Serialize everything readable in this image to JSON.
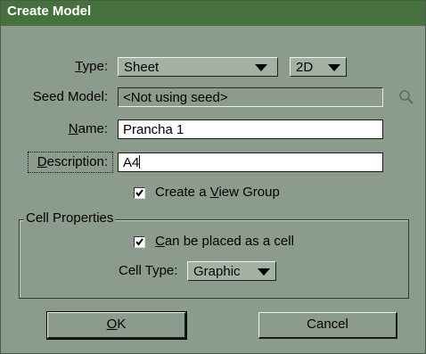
{
  "dialog": {
    "title": "Create Model",
    "type_label": "Type:",
    "type_value": "Sheet",
    "dim_value": "2D",
    "seed_label": "Seed Model:",
    "seed_value": "<Not using seed>",
    "name_label": "Name:",
    "name_value": "Prancha 1",
    "description_label": "Description:",
    "description_value": "A4",
    "view_group_label": "Create a View Group",
    "view_group_checked": true,
    "cell_properties_label": "Cell Properties",
    "placed_as_cell_label": "Can be placed as a cell",
    "placed_as_cell_checked": true,
    "cell_type_label": "Cell Type:",
    "cell_type_value": "Graphic",
    "ok_label": "OK",
    "cancel_label": "Cancel"
  },
  "icons": {
    "seed_browse": "magnifier-icon",
    "checkbox_mark": "checkmark-icon"
  },
  "colors": {
    "titlebar": "#46713f",
    "dialog_bg": "#8c9c8c"
  }
}
